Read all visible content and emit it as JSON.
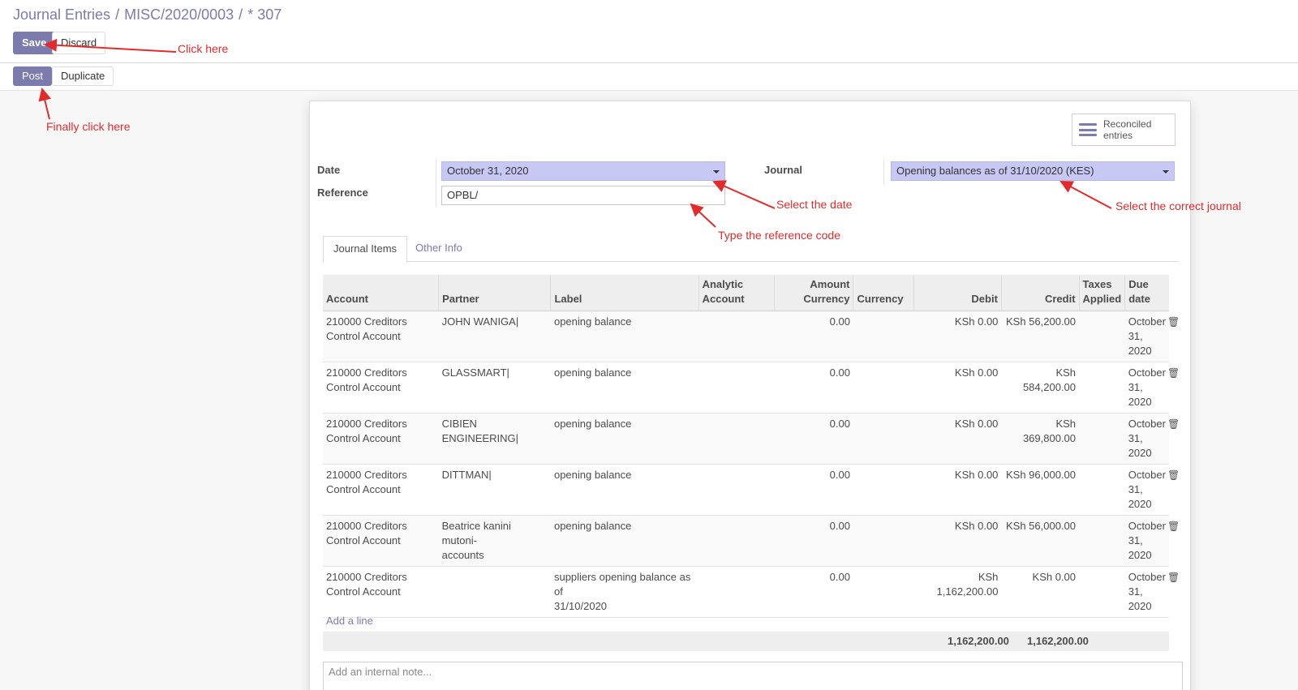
{
  "breadcrumb": {
    "root": "Journal Entries",
    "parent": "MISC/2020/0003",
    "current": "* 307"
  },
  "buttons": {
    "save": "Save",
    "discard": "Discard",
    "post": "Post",
    "duplicate": "Duplicate"
  },
  "smart_button": {
    "line1": "Reconciled",
    "line2": "entries"
  },
  "form": {
    "date_label": "Date",
    "date_value": "October 31, 2020",
    "reference_label": "Reference",
    "reference_value": "OPBL/",
    "journal_label": "Journal",
    "journal_value": "Opening balances as of 31/10/2020 (KES)"
  },
  "tabs": [
    "Journal Items",
    "Other Info"
  ],
  "table": {
    "headers": {
      "account": "Account",
      "partner": "Partner",
      "label": "Label",
      "analytic_1": "Analytic",
      "analytic_2": "Account",
      "amount_1": "Amount",
      "amount_2": "Currency",
      "currency": "Currency",
      "debit": "Debit",
      "credit": "Credit",
      "taxes_1": "Taxes",
      "taxes_2": "Applied",
      "due_1": "Due",
      "due_2": "date"
    },
    "rows": [
      {
        "account_1": "210000 Creditors",
        "account_2": "Control Account",
        "partner_1": "JOHN WANIGA|",
        "partner_2": "",
        "label_1": "opening balance",
        "label_2": "",
        "amount": "0.00",
        "debit": "KSh 0.00",
        "credit": "KSh 56,200.00",
        "due_1": "October",
        "due_2": "31,",
        "due_3": "2020"
      },
      {
        "account_1": "210000 Creditors",
        "account_2": "Control Account",
        "partner_1": "GLASSMART|",
        "partner_2": "",
        "label_1": "opening balance",
        "label_2": "",
        "amount": "0.00",
        "debit": "KSh 0.00",
        "credit": "KSh 584,200.00",
        "due_1": "October",
        "due_2": "31,",
        "due_3": "2020"
      },
      {
        "account_1": "210000 Creditors",
        "account_2": "Control Account",
        "partner_1": "CIBIEN",
        "partner_2": "ENGINEERING|",
        "label_1": "opening balance",
        "label_2": "",
        "amount": "0.00",
        "debit": "KSh 0.00",
        "credit": "KSh 369,800.00",
        "due_1": "October",
        "due_2": "31,",
        "due_3": "2020"
      },
      {
        "account_1": "210000 Creditors",
        "account_2": "Control Account",
        "partner_1": "DITTMAN|",
        "partner_2": "",
        "label_1": "opening balance",
        "label_2": "",
        "amount": "0.00",
        "debit": "KSh 0.00",
        "credit": "KSh 96,000.00",
        "due_1": "October",
        "due_2": "31,",
        "due_3": "2020"
      },
      {
        "account_1": "210000 Creditors",
        "account_2": "Control Account",
        "partner_1": "Beatrice kanini mutoni-",
        "partner_2": "accounts",
        "label_1": "opening balance",
        "label_2": "",
        "amount": "0.00",
        "debit": "KSh 0.00",
        "credit": "KSh 56,000.00",
        "due_1": "October",
        "due_2": "31,",
        "due_3": "2020"
      },
      {
        "account_1": "210000 Creditors",
        "account_2": "Control Account",
        "partner_1": "",
        "partner_2": "",
        "label_1": "suppliers opening balance as of",
        "label_2": "31/10/2020",
        "amount": "0.00",
        "debit": "KSh 1,162,200.00",
        "credit": "KSh 0.00",
        "due_1": "October",
        "due_2": "31,",
        "due_3": "2020"
      }
    ],
    "add_line": "Add a line",
    "total_debit": "1,162,200.00",
    "total_credit": "1,162,200.00"
  },
  "note_placeholder": "Add an internal note...",
  "annotations": {
    "click_here": "Click here",
    "finally": "Finally click here",
    "select_date": "Select the date",
    "type_reference": "Type the reference code",
    "select_journal": "Select the correct journal"
  },
  "colors": {
    "primary": "#7c7bad",
    "annotation": "#e32b2b",
    "select_bg": "#c8c8f5"
  }
}
